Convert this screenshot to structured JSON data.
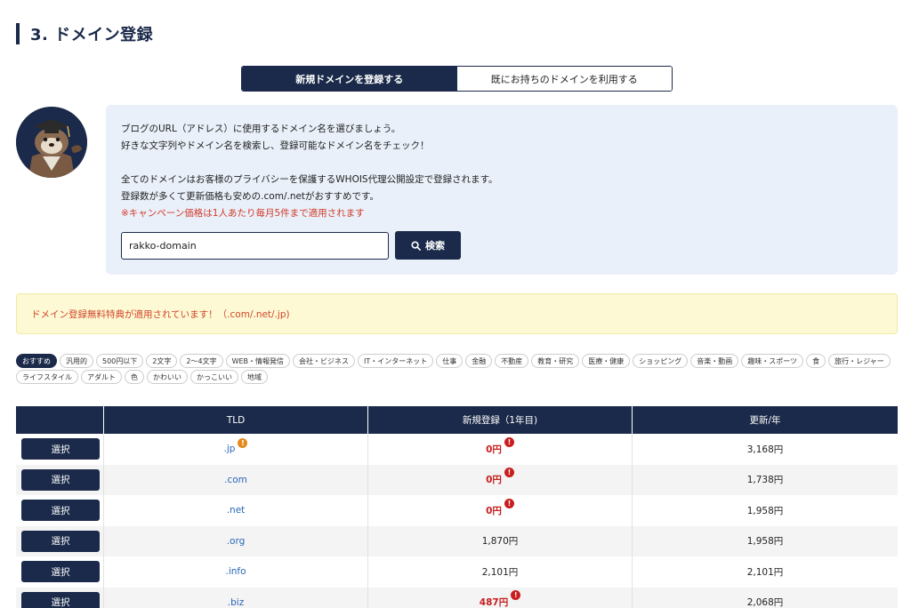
{
  "section": {
    "title": "3. ドメイン登録"
  },
  "mode_toggle": {
    "new_label": "新規ドメインを登録する",
    "existing_label": "既にお持ちのドメインを利用する"
  },
  "info": {
    "line1": "ブログのURL（アドレス）に使用するドメイン名を選びましょう。",
    "line2": "好きな文字列やドメイン名を検索し、登録可能なドメイン名をチェック！",
    "line3": "全てのドメインはお客様のプライバシーを保護するWHOIS代理公開設定で登録されます。",
    "line4": "登録数が多くて更新価格も安めの.com/.netがおすすめです。",
    "warning": "※キャンペーン価格は1人あたり毎月5件まで適用されます"
  },
  "search": {
    "value": "rakko-domain",
    "button_label": "検索"
  },
  "notice": {
    "text": "ドメイン登録無料特典が適用されています！（.com/.net/.jp)"
  },
  "categories": [
    {
      "label": "おすすめ",
      "active": true
    },
    {
      "label": "汎用的",
      "active": false
    },
    {
      "label": "500円以下",
      "active": false
    },
    {
      "label": "2文字",
      "active": false
    },
    {
      "label": "2〜4文字",
      "active": false
    },
    {
      "label": "WEB・情報発信",
      "active": false
    },
    {
      "label": "会社・ビジネス",
      "active": false
    },
    {
      "label": "IT・インターネット",
      "active": false
    },
    {
      "label": "仕事",
      "active": false
    },
    {
      "label": "金融",
      "active": false
    },
    {
      "label": "不動産",
      "active": false
    },
    {
      "label": "教育・研究",
      "active": false
    },
    {
      "label": "医療・健康",
      "active": false
    },
    {
      "label": "ショッピング",
      "active": false
    },
    {
      "label": "音楽・動画",
      "active": false
    },
    {
      "label": "趣味・スポーツ",
      "active": false
    },
    {
      "label": "食",
      "active": false
    },
    {
      "label": "旅行・レジャー",
      "active": false
    },
    {
      "label": "ライフスタイル",
      "active": false
    },
    {
      "label": "アダルト",
      "active": false
    },
    {
      "label": "色",
      "active": false
    },
    {
      "label": "かわいい",
      "active": false
    },
    {
      "label": "かっこいい",
      "active": false
    },
    {
      "label": "地域",
      "active": false
    }
  ],
  "table": {
    "headers": [
      "",
      "TLD",
      "新規登録（1年目)",
      "更新/年"
    ],
    "select_label": "選択",
    "rows": [
      {
        "tld": ".jp",
        "tld_badge": "orange",
        "new": "0円",
        "new_badge": true,
        "new_free": true,
        "renew": "3,168円"
      },
      {
        "tld": ".com",
        "tld_badge": "",
        "new": "0円",
        "new_badge": true,
        "new_free": true,
        "renew": "1,738円"
      },
      {
        "tld": ".net",
        "tld_badge": "",
        "new": "0円",
        "new_badge": true,
        "new_free": true,
        "renew": "1,958円"
      },
      {
        "tld": ".org",
        "tld_badge": "",
        "new": "1,870円",
        "new_badge": false,
        "new_free": false,
        "renew": "1,958円"
      },
      {
        "tld": ".info",
        "tld_badge": "",
        "new": "2,101円",
        "new_badge": false,
        "new_free": false,
        "renew": "2,101円"
      },
      {
        "tld": ".biz",
        "tld_badge": "",
        "new": "487円",
        "new_badge": true,
        "new_free": true,
        "renew": "2,068円"
      }
    ]
  },
  "colors": {
    "navy": "#1b2a4a",
    "campaign_red": "#c81e1e",
    "link_blue": "#2a66b8",
    "notice_bg": "#fdf9d4"
  }
}
